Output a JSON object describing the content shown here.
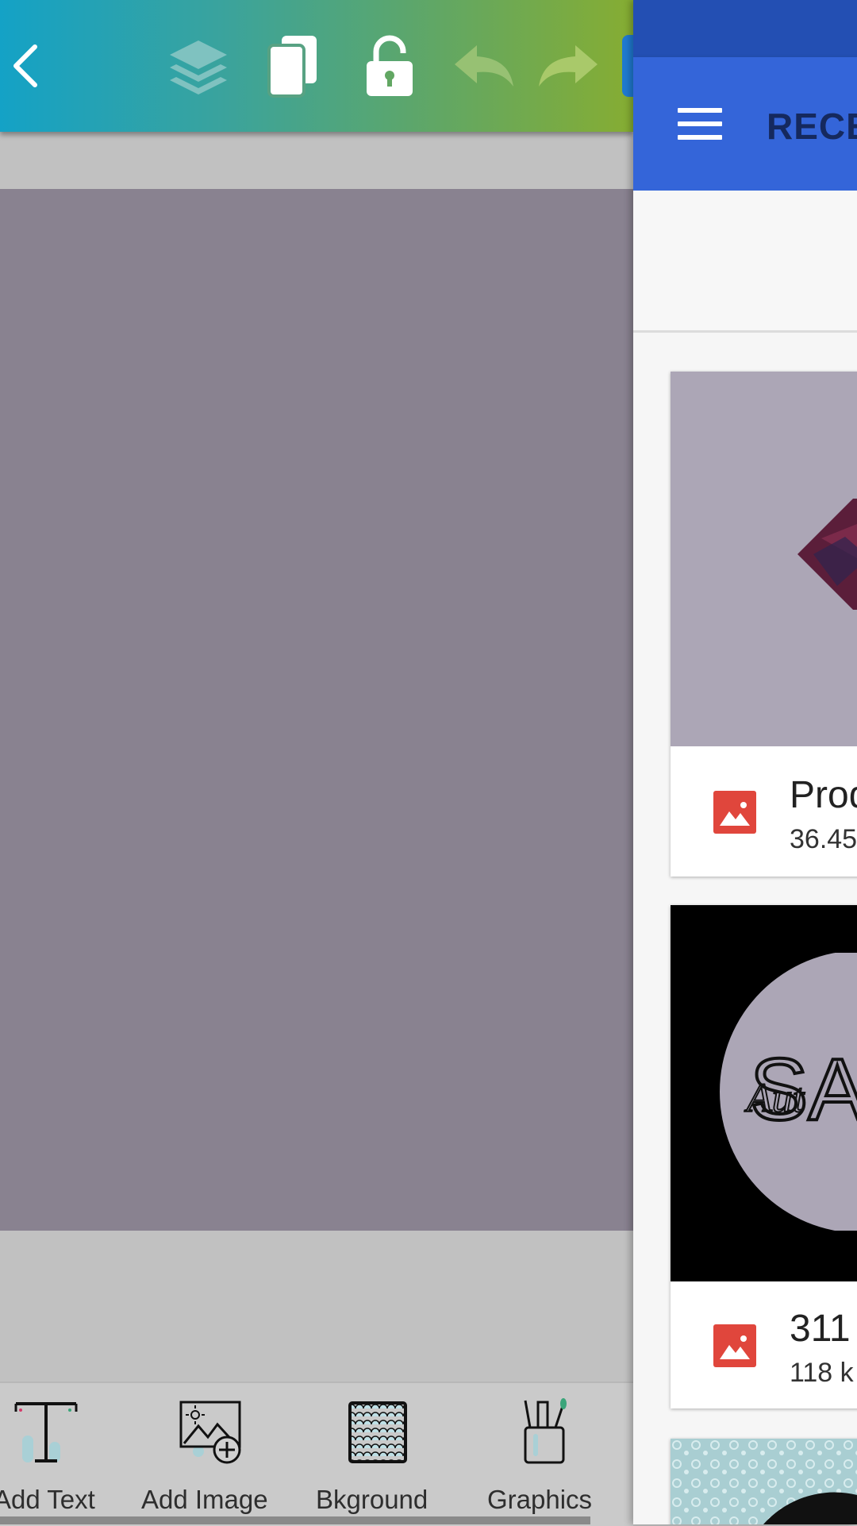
{
  "toolbar": {
    "icons": [
      "back-icon",
      "layers-icon",
      "duplicate-icon",
      "unlock-icon",
      "undo-icon",
      "redo-icon"
    ],
    "colors": {
      "gradient_start": "#14a2c6",
      "gradient_end": "#86ad32"
    }
  },
  "canvas": {
    "color": "#898290"
  },
  "bottom_tools": [
    {
      "label": "Add Text",
      "icon": "text-tool-icon"
    },
    {
      "label": "Add Image",
      "icon": "add-image-icon"
    },
    {
      "label": "Bkground",
      "icon": "background-pattern-icon"
    },
    {
      "label": "Graphics",
      "icon": "graphics-pencil-cup-icon"
    }
  ],
  "drawer": {
    "title": "RECEN",
    "files": [
      {
        "name": "Prod",
        "size": "36.45",
        "icon": "image-file-icon"
      },
      {
        "name": "311",
        "size": "118 k",
        "icon": "image-file-icon"
      }
    ]
  }
}
